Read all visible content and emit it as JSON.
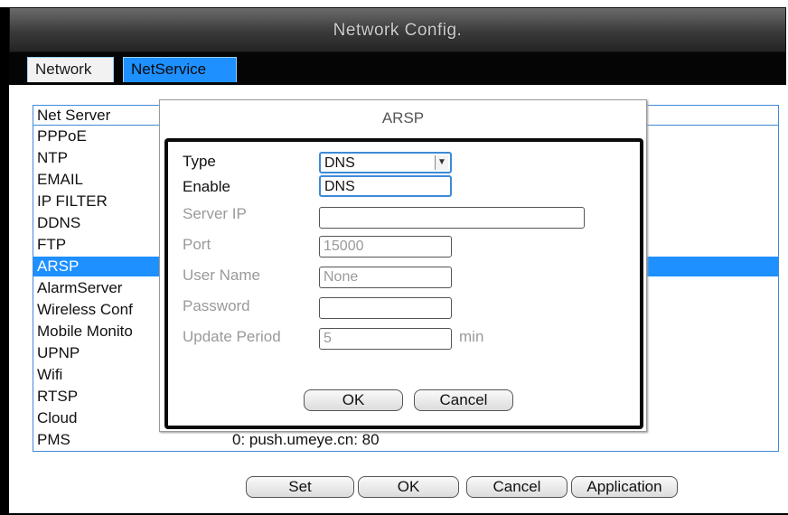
{
  "window": {
    "title": "Network Config."
  },
  "tabs": [
    {
      "label": "Network",
      "active": false
    },
    {
      "label": "NetService",
      "active": true
    }
  ],
  "service_list": {
    "header": "Net Server",
    "items": [
      {
        "label": "PPPoE"
      },
      {
        "label": "NTP"
      },
      {
        "label": "EMAIL"
      },
      {
        "label": "IP FILTER"
      },
      {
        "label": "DDNS"
      },
      {
        "label": "FTP"
      },
      {
        "label": "ARSP",
        "selected": true
      },
      {
        "label": "AlarmServer"
      },
      {
        "label": "Wireless Conf"
      },
      {
        "label": "Mobile Monito"
      },
      {
        "label": "UPNP"
      },
      {
        "label": "Wifi"
      },
      {
        "label": "RTSP"
      },
      {
        "label": "Cloud"
      },
      {
        "label": "PMS",
        "value": "0: push.umeye.cn: 80"
      }
    ]
  },
  "dialog": {
    "title": "ARSP",
    "type_label": "Type",
    "type_value": "DNS",
    "enable_label": "Enable",
    "enable_value": "DNS",
    "server_ip_label": "Server IP",
    "server_ip_value": "",
    "port_label": "Port",
    "port_value": "15000",
    "username_label": "User Name",
    "username_value": "None",
    "password_label": "Password",
    "password_value": "",
    "update_period_label": "Update Period",
    "update_period_value": "5",
    "update_period_unit": "min",
    "ok_label": "OK",
    "cancel_label": "Cancel"
  },
  "bottom_buttons": {
    "set_label": "Set",
    "ok_label": "OK",
    "cancel_label": "Cancel",
    "application_label": "Application"
  },
  "colors": {
    "accent": "#1e90ff",
    "title_bg": "#3a3a3a",
    "disabled_text": "#9a9a9a"
  }
}
